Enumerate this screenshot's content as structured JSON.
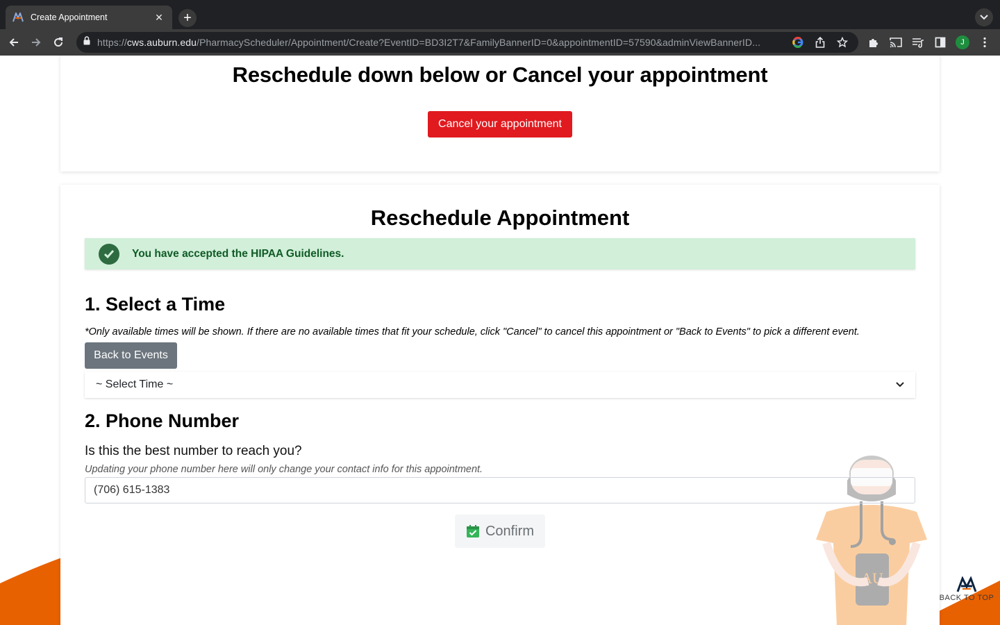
{
  "browser": {
    "tab_title": "Create Appointment",
    "url_scheme": "https://",
    "url_host": "cws.auburn.edu",
    "url_path": "/PharmacyScheduler/Appointment/Create?EventID=BD3I2T7&FamilyBannerID=0&appointmentID=57590&adminViewBannerID...",
    "profile_initial": "J"
  },
  "top_card": {
    "heading": "Reschedule down below or Cancel your appointment",
    "cancel_button": "Cancel your appointment"
  },
  "main_card": {
    "heading": "Reschedule Appointment",
    "alert": "You have accepted the HIPAA Guidelines.",
    "section1": {
      "heading": "1. Select a Time",
      "note": "*Only available times will be shown. If there are no available times that fit your schedule, click \"Cancel\" to cancel this appointment or \"Back to Events\" to pick a different event.",
      "back_button": "Back to Events",
      "select_value": "~ Select Time ~"
    },
    "section2": {
      "heading": "2. Phone Number",
      "question": "Is this the best number to reach you?",
      "hint": "Updating your phone number here will only change your contact info for this appointment.",
      "phone_value": "(706) 615-1383"
    },
    "confirm_button": "Confirm"
  },
  "back_to_top": "BACK TO TOP",
  "colors": {
    "cancel_red": "#e01a1f",
    "alert_green_bg": "#d1efd9",
    "alert_green_text": "#105b26",
    "back_gray": "#6c757d",
    "auburn_orange": "#e86100",
    "auburn_navy": "#0c2340"
  },
  "icons": [
    "auburn-favicon-icon",
    "close-icon",
    "plus-icon",
    "chevron-down-icon",
    "back-arrow-icon",
    "forward-arrow-icon",
    "reload-icon",
    "lock-icon",
    "google-icon",
    "share-icon",
    "star-icon",
    "extensions-icon",
    "cast-icon",
    "reading-list-icon",
    "sidebar-icon",
    "kebab-menu-icon",
    "check-circle-icon",
    "calendar-check-icon"
  ]
}
